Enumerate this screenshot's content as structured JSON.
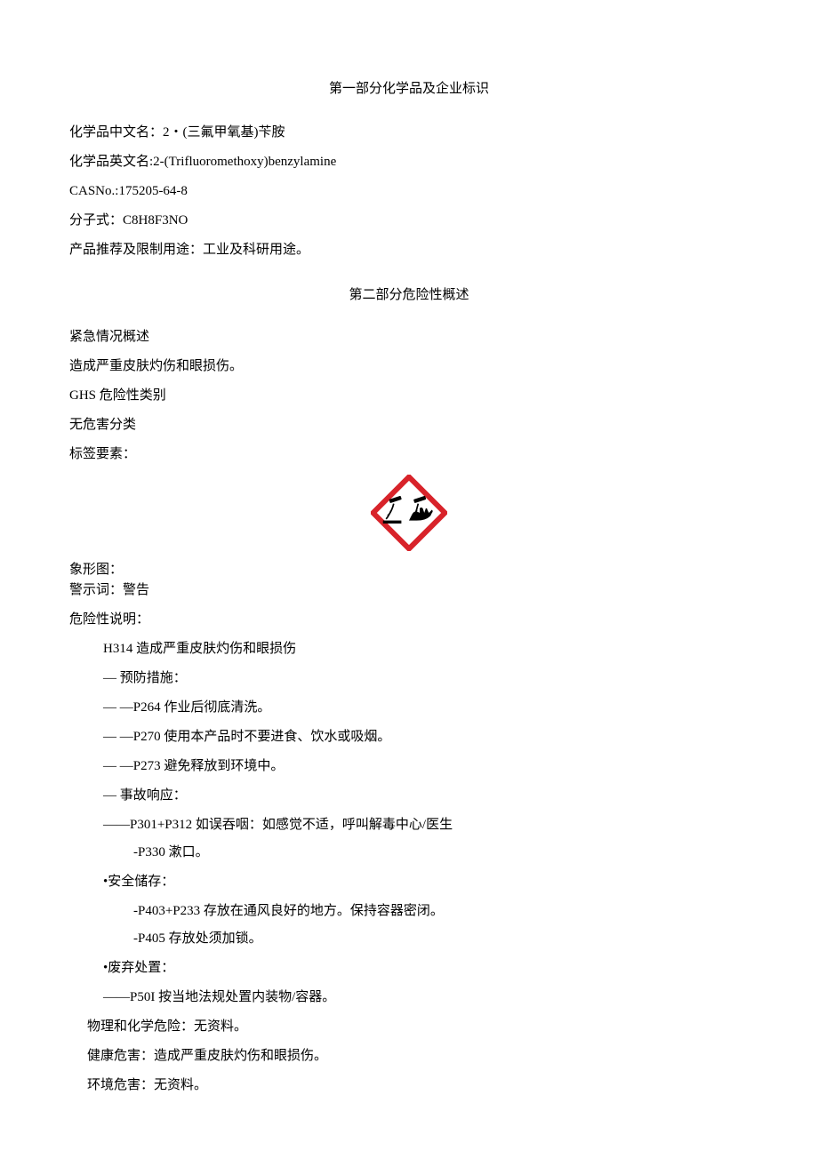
{
  "section1": {
    "title": "第一部分化学品及企业标识",
    "chinese_name_label": "化学品中文名：",
    "chinese_name_value": "2・(三氟甲氧基)苄胺",
    "english_name_label": "化学品英文名:",
    "english_name_value": "2-(Trifluoromethoxy)benzylamine",
    "cas_label": "CASNo.:",
    "cas_value": "175205-64-8",
    "formula_label": "分子式：",
    "formula_value": "C8H8F3NO",
    "use_label": "产品推荐及限制用途：",
    "use_value": "工业及科研用途。"
  },
  "section2": {
    "title": "第二部分危险性概述",
    "emergency_label": "紧急情况概述",
    "emergency_value": "造成严重皮肤灼伤和眼损伤。",
    "ghs_label": "GHS 危险性类别",
    "ghs_value": "无危害分类",
    "label_elements": "标签要素：",
    "pictogram_label": "象形图：",
    "signal_word_label": "警示词：",
    "signal_word_value": "警告",
    "hazard_stmt_label": "危险性说明：",
    "h314": "H314 造成严重皮肤灼伤和眼损伤",
    "precaution_header": "— 预防措施：",
    "p264": "—  —P264 作业后彻底清洗。",
    "p270": "—  —P270 使用本产品时不要进食、饮水或吸烟。",
    "p273": "—  —P273 避免释放到环境中。",
    "response_header": "— 事故响应：",
    "p301_p312": "——P301+P312 如误吞咽：如感觉不适，呼叫解毒中心/医生",
    "p330": "-P330 漱口。",
    "storage_header": "•安全储存：",
    "p403_p233": "-P403+P233 存放在通风良好的地方。保持容器密闭。",
    "p405": "-P405 存放处须加锁。",
    "disposal_header": "•废弃处置：",
    "p501": "——P50I 按当地法规处置内装物/容器。",
    "phys_chem_label": "物理和化学危险：",
    "phys_chem_value": "无资料。",
    "health_label": "健康危害：",
    "health_value": "造成严重皮肤灼伤和眼损伤。",
    "env_label": "环境危害：",
    "env_value": "无资料。"
  }
}
